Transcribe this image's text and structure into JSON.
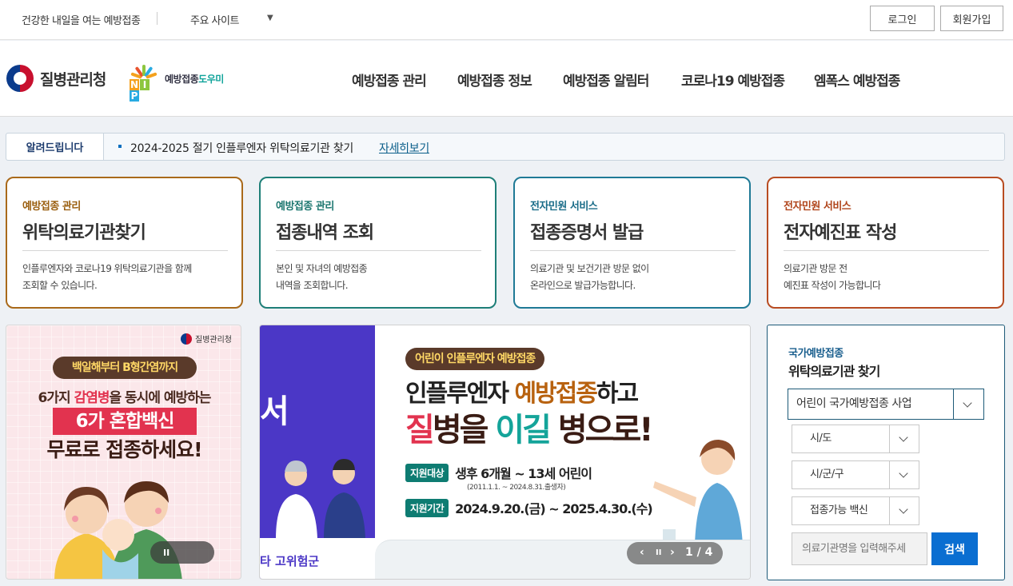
{
  "topbar": {
    "slogan": "건강한 내일을 여는 예방접종",
    "sites_label": "주요 사이트",
    "sites_caret": "▼",
    "login": "로그인",
    "join": "회원가입"
  },
  "header": {
    "agency_name": "질병관리청",
    "nip_letters": [
      "N",
      "I",
      "P"
    ],
    "nip_name_a": "예방접종",
    "nip_name_b": "도우미",
    "menu": [
      "예방접종 관리",
      "예방접종 정보",
      "예방접종 알림터",
      "코로나19 예방접종",
      "엠폭스 예방접종"
    ]
  },
  "notice": {
    "label": "알려드립니다",
    "text": "2024-2025 절기 인플루엔자 위탁의료기관 찾기",
    "link": "자세히보기"
  },
  "cards": [
    {
      "category": "예방접종 관리",
      "title": "위탁의료기관찾기",
      "desc_1": "인플루엔자와 코로나19 위탁의료기관을 함께",
      "desc_2": "조회할 수 있습니다."
    },
    {
      "category": "예방접종 관리",
      "title": "접종내역 조회",
      "desc_1": "본인 및 자녀의 예방접종",
      "desc_2": "내역을 조회합니다."
    },
    {
      "category": "전자민원 서비스",
      "title": "접종증명서 발급",
      "desc_1": "의료기관 및 보건기관 방문 없이",
      "desc_2": "온라인으로 발급가능합니다."
    },
    {
      "category": "전자민원 서비스",
      "title": "전자예진표 작성",
      "desc_1": "의료기관 방문 전",
      "desc_2": "예진표 작성이 가능합니다"
    }
  ],
  "promo_left": {
    "logo": "질병관리청",
    "ribbon": "백일해부터 B형간염까지",
    "line1_a": "6가지 ",
    "line1_b": "감염병",
    "line1_c": "을 동시에 예방하는",
    "line2": "6가 혼합백신",
    "line3": "무료로 접종하세요!",
    "pause": "II"
  },
  "promo_center": {
    "side_text": "서",
    "side_bottom": "타 고위험군",
    "badge": "어린이 인플루엔자 예방접종",
    "h1_a": "인플루엔자 ",
    "h1_b": "예방접종",
    "h1_c": "하고",
    "h2_a": "질",
    "h2_b": "병을 ",
    "h2_c": "이길",
    "h2_d": " 병으로!",
    "target_tag": "지원대상",
    "target_val": "생후 6개월 ~ 13세 어린이",
    "target_sub": "(2011.1.1. ~ 2024.8.31.출생자)",
    "period_tag": "지원기간",
    "period_val": "2024.9.20.(금) ~ 2025.4.30.(수)",
    "ctrl_prev": "‹",
    "ctrl_pause": "II",
    "ctrl_next": "›",
    "ctrl_page": "1 / 4"
  },
  "search": {
    "subtitle": "국가예방접종",
    "title": "위탁의료기관 찾기",
    "program": "어린이 국가예방접종 사업",
    "sido": "시/도",
    "sigungu": "시/군/구",
    "vaccine": "접종가능 백신",
    "input_placeholder": "의료기관명을 입력해주세",
    "button": "검색"
  },
  "colors": {
    "card1": "#a9691a",
    "card2": "#1e7f78",
    "card3": "#1f7a96",
    "card4": "#b84c22",
    "search_button": "#0a6ed1"
  }
}
